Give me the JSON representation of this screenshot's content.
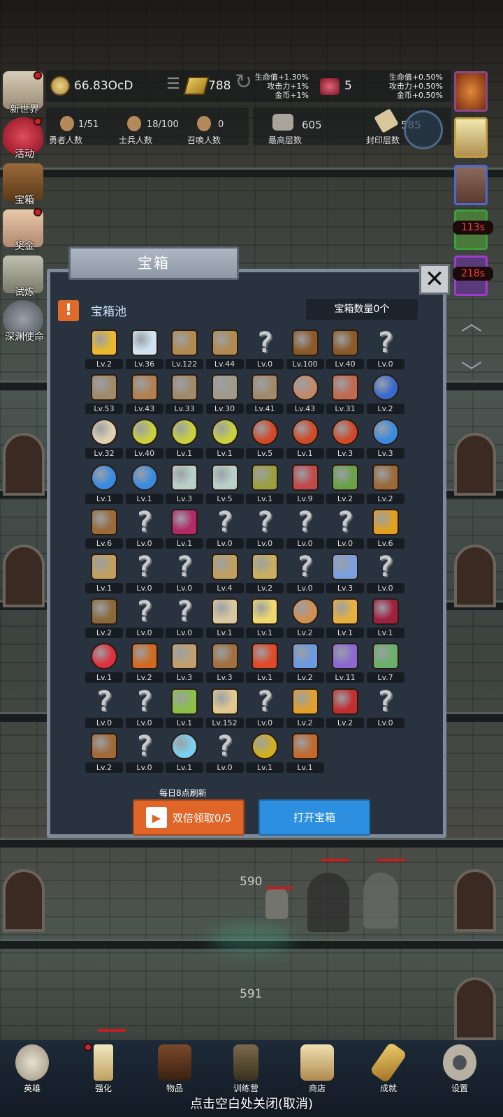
{
  "hud": {
    "gold": "66.83OcD",
    "bars": "788",
    "gems": "5",
    "buff_left": [
      "生命值+1.30%",
      "攻击力+1%",
      "金币+1%"
    ],
    "buff_right": [
      "生命值+0.50%",
      "攻击力+0.50%",
      "金币+0.50%"
    ],
    "heroes_value": "1/51",
    "heroes_label": "勇者人数",
    "soldiers_value": "18/100",
    "soldiers_label": "士兵人数",
    "summon_value": "0",
    "summon_label": "召唤人数",
    "maxfloor_value": "605",
    "maxfloor_label": "最高层数",
    "sealed_value": "585",
    "sealed_label": "封印层数"
  },
  "sidebar": [
    "新世界",
    "活动",
    "宝箱",
    "奖金",
    "试炼",
    "深渊使命"
  ],
  "timers": [
    "113s",
    "218s"
  ],
  "modal": {
    "title": "宝箱",
    "pool_title": "宝箱池",
    "count": "宝箱数量0个",
    "refresh_note": "每日8点刷新",
    "double_button": "双倍领取0/5",
    "open_button": "打开宝箱",
    "close_icon": "close-icon"
  },
  "items": [
    {
      "icon": "crown",
      "lv": "Lv.2"
    },
    {
      "icon": "diamond",
      "lv": "Lv.36"
    },
    {
      "icon": "sword",
      "lv": "Lv.122"
    },
    {
      "icon": "sword",
      "lv": "Lv.44"
    },
    {
      "icon": "unknown",
      "lv": "Lv.0"
    },
    {
      "icon": "armor",
      "lv": "Lv.100"
    },
    {
      "icon": "armor",
      "lv": "Lv.40"
    },
    {
      "icon": "unknown",
      "lv": "Lv.0"
    },
    {
      "icon": "helmet",
      "lv": "Lv.53"
    },
    {
      "icon": "dagger",
      "lv": "Lv.43"
    },
    {
      "icon": "helmet",
      "lv": "Lv.33"
    },
    {
      "icon": "hammer",
      "lv": "Lv.30"
    },
    {
      "icon": "helmet",
      "lv": "Lv.41"
    },
    {
      "icon": "meat",
      "lv": "Lv.43"
    },
    {
      "icon": "steak",
      "lv": "Lv.31"
    },
    {
      "icon": "bag",
      "lv": "Lv.2"
    },
    {
      "icon": "bread",
      "lv": "Lv.32"
    },
    {
      "icon": "potion-yellow",
      "lv": "Lv.40"
    },
    {
      "icon": "potion-yellow",
      "lv": "Lv.1"
    },
    {
      "icon": "potion-yellow",
      "lv": "Lv.1"
    },
    {
      "icon": "potion-red",
      "lv": "Lv.5"
    },
    {
      "icon": "potion-red",
      "lv": "Lv.1"
    },
    {
      "icon": "potion-red",
      "lv": "Lv.3"
    },
    {
      "icon": "potion-blue",
      "lv": "Lv.3"
    },
    {
      "icon": "potion-blue",
      "lv": "Lv.1"
    },
    {
      "icon": "potion-blue",
      "lv": "Lv.1"
    },
    {
      "icon": "bottle",
      "lv": "Lv.3"
    },
    {
      "icon": "bottle",
      "lv": "Lv.5"
    },
    {
      "icon": "bottle-green",
      "lv": "Lv.1"
    },
    {
      "icon": "bottle-red",
      "lv": "Lv.9"
    },
    {
      "icon": "boot-green",
      "lv": "Lv.2"
    },
    {
      "icon": "boot",
      "lv": "Lv.2"
    },
    {
      "icon": "boot",
      "lv": "Lv.6"
    },
    {
      "icon": "unknown",
      "lv": "Lv.0"
    },
    {
      "icon": "boot-magenta",
      "lv": "Lv.1"
    },
    {
      "icon": "unknown",
      "lv": "Lv.0"
    },
    {
      "icon": "unknown",
      "lv": "Lv.0"
    },
    {
      "icon": "unknown",
      "lv": "Lv.0"
    },
    {
      "icon": "unknown",
      "lv": "Lv.0"
    },
    {
      "icon": "torch",
      "lv": "Lv.6"
    },
    {
      "icon": "staff",
      "lv": "Lv.1"
    },
    {
      "icon": "unknown",
      "lv": "Lv.0"
    },
    {
      "icon": "unknown",
      "lv": "Lv.0"
    },
    {
      "icon": "staff",
      "lv": "Lv.4"
    },
    {
      "icon": "potato",
      "lv": "Lv.2"
    },
    {
      "icon": "unknown",
      "lv": "Lv.0"
    },
    {
      "icon": "wand-blue",
      "lv": "Lv.3"
    },
    {
      "icon": "unknown",
      "lv": "Lv.0"
    },
    {
      "icon": "backpack",
      "lv": "Lv.2"
    },
    {
      "icon": "unknown",
      "lv": "Lv.0"
    },
    {
      "icon": "unknown",
      "lv": "Lv.0"
    },
    {
      "icon": "club",
      "lv": "Lv.1"
    },
    {
      "icon": "cheese",
      "lv": "Lv.1"
    },
    {
      "icon": "pie",
      "lv": "Lv.2"
    },
    {
      "icon": "jar",
      "lv": "Lv.1"
    },
    {
      "icon": "crystal",
      "lv": "Lv.1"
    },
    {
      "icon": "orb-red",
      "lv": "Lv.1"
    },
    {
      "icon": "gem-box",
      "lv": "Lv.2"
    },
    {
      "icon": "bow",
      "lv": "Lv.3"
    },
    {
      "icon": "crossbow",
      "lv": "Lv.3"
    },
    {
      "icon": "glove-red",
      "lv": "Lv.1"
    },
    {
      "icon": "glove-blue",
      "lv": "Lv.2"
    },
    {
      "icon": "glove-purple",
      "lv": "Lv.11"
    },
    {
      "icon": "shield",
      "lv": "Lv.7"
    },
    {
      "icon": "unknown",
      "lv": "Lv.0"
    },
    {
      "icon": "unknown",
      "lv": "Lv.0"
    },
    {
      "icon": "wand-green",
      "lv": "Lv.1"
    },
    {
      "icon": "beer",
      "lv": "Lv.152"
    },
    {
      "icon": "unknown",
      "lv": "Lv.0"
    },
    {
      "icon": "pickaxe",
      "lv": "Lv.2"
    },
    {
      "icon": "book",
      "lv": "Lv.2"
    },
    {
      "icon": "unknown",
      "lv": "Lv.0"
    },
    {
      "icon": "whip",
      "lv": "Lv.2"
    },
    {
      "icon": "unknown",
      "lv": "Lv.0"
    },
    {
      "icon": "crystal-ball",
      "lv": "Lv.1"
    },
    {
      "icon": "unknown",
      "lv": "Lv.0"
    },
    {
      "icon": "golden-orb",
      "lv": "Lv.1"
    },
    {
      "icon": "spear",
      "lv": "Lv.1"
    }
  ],
  "floors": [
    "590",
    "591"
  ],
  "nav": [
    "英雄",
    "强化",
    "物品",
    "训练营",
    "商店",
    "成就",
    "设置"
  ],
  "close_hint": "点击空白处关闭(取消)"
}
